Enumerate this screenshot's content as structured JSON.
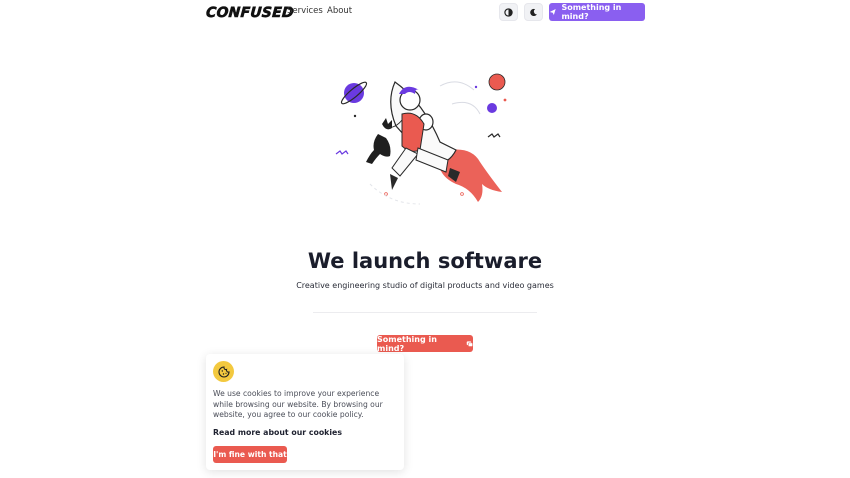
{
  "header": {
    "logo_text": "CONFUSED",
    "nav": [
      {
        "label": "Services"
      },
      {
        "label": "About"
      }
    ],
    "contrast_icon": "contrast-icon",
    "dark_mode_icon": "moon-icon",
    "cta_label": "Something in mind?",
    "cta_icon": "send-icon"
  },
  "hero": {
    "illustration": "rocket-illustration",
    "title": "We launch software",
    "subtitle": "Creative engineering studio of digital products and video games",
    "cta_label": "Something in mind?",
    "cta_icon": "chat-icon"
  },
  "cookie_banner": {
    "icon": "cookie-icon",
    "text": "We use cookies to improve your experience while browsing our website. By browsing our website, you agree to our cookie policy.",
    "link_label": "Read more about our cookies",
    "accept_label": "I'm fine with that"
  },
  "colors": {
    "primary_purple": "#8a5ff0",
    "accent_red": "#ea5a50",
    "cookie_yellow": "#f3c93f",
    "text_dark": "#1a1d2b"
  }
}
